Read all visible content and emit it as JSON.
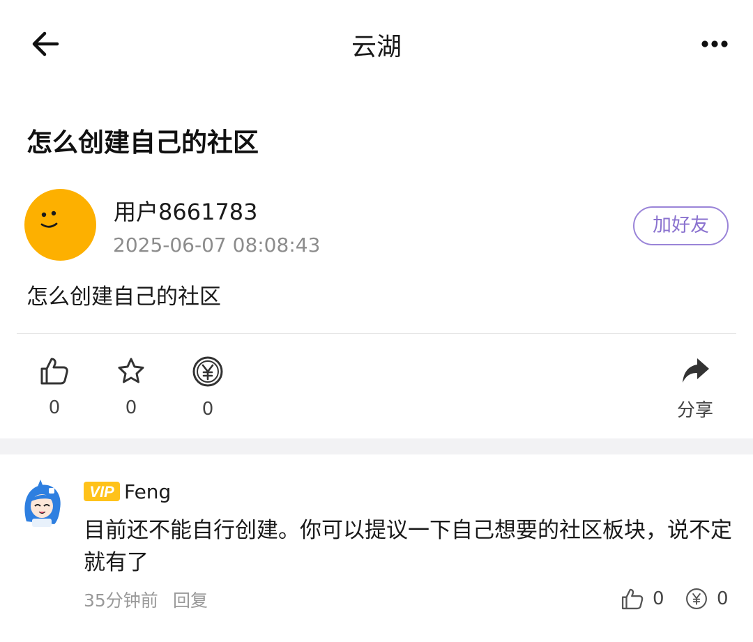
{
  "header": {
    "title": "云湖"
  },
  "post": {
    "title": "怎么创建自己的社区",
    "author": {
      "name": "用户8661783",
      "time": "2025-06-07 08:08:43",
      "avatar_color": "#fdb000"
    },
    "add_friend_label": "加好友",
    "body": "怎么创建自己的社区",
    "actions": {
      "like_count": "0",
      "favorite_count": "0",
      "tip_count": "0",
      "share_label": "分享"
    }
  },
  "comment": {
    "badge": "VIP",
    "author": "Feng",
    "text": "目前还不能自行创建。你可以提议一下自己想要的社区板块，说不定就有了",
    "time": "35分钟前",
    "reply_label": "回复",
    "like_count": "0",
    "tip_count": "0"
  },
  "colors": {
    "accent_purple": "#8a72cf",
    "vip_yellow": "#ffc21a",
    "avatar_orange": "#fdb000"
  },
  "icons": [
    "back-arrow-icon",
    "more-dots-icon",
    "thumbs-up-icon",
    "star-icon",
    "yuan-coin-icon",
    "share-arrow-icon",
    "vip-badge-icon"
  ]
}
